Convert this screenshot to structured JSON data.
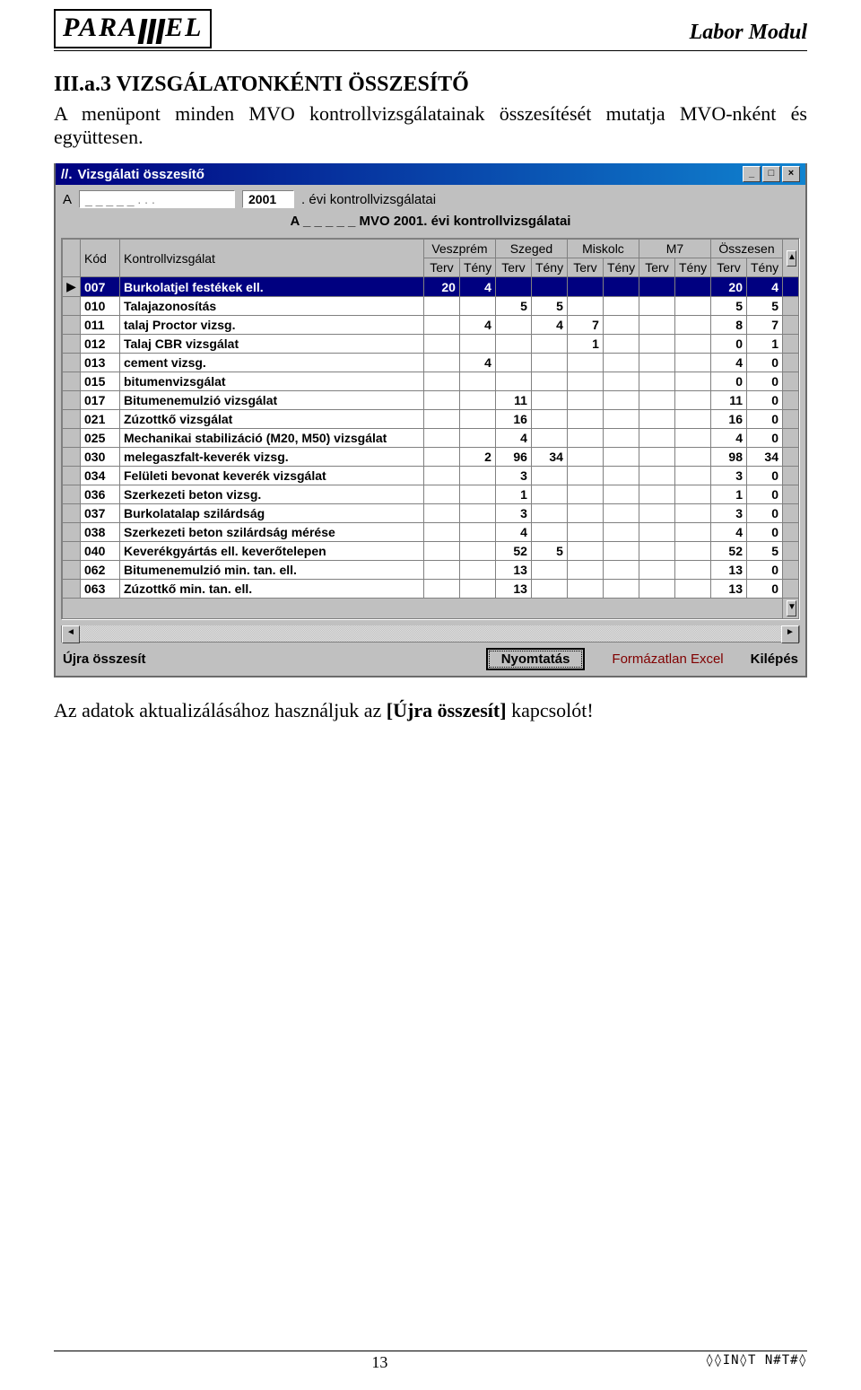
{
  "header": {
    "logo_left": "PARA",
    "logo_right": "EL",
    "doc_title": "Labor Modul"
  },
  "section": {
    "heading": "III.a.3 VIZSGÁLATONKÉNTI ÖSSZESÍTŐ",
    "body": "A menüpont minden MVO kontrollvizsgálatainak összesítését mutatja MVO-nként és együttesen.",
    "tail_pre": "Az adatok aktualizálásához használjuk az ",
    "tail_bold": "[Újra összesít]",
    "tail_post": " kapcsolót!"
  },
  "window": {
    "title": "Vizsgálati összesítő",
    "min": "_",
    "max": "□",
    "close": "×",
    "org_label": "A",
    "org_value": "  _ _ _ _ _ . . .",
    "year": "2001",
    "year_suffix": ". évi kontrollvizsgálatai",
    "subtitle_pre": "A _ _ _ _ _  MVO 2001. évi kontrollvizsgálatai"
  },
  "columns": {
    "marker": "",
    "kod": "Kód",
    "kv": "Kontrollvizsgálat",
    "city1": "Veszprém",
    "city2": "Szeged",
    "city3": "Miskolc",
    "city4": "M7",
    "total": "Összesen",
    "terv": "Terv",
    "teny": "Tény"
  },
  "rows": [
    {
      "code": "007",
      "name": "Burkolatjel festékek ell.",
      "v": [
        "20",
        "4",
        "",
        "",
        "",
        "",
        "",
        "",
        "20",
        "4"
      ],
      "sel": true,
      "marker": "▶"
    },
    {
      "code": "010",
      "name": "Talajazonosítás",
      "v": [
        "",
        "",
        "5",
        "5",
        "",
        "",
        "",
        "",
        "5",
        "5"
      ]
    },
    {
      "code": "011",
      "name": "talaj Proctor vizsg.",
      "v": [
        "",
        "4",
        "",
        "4",
        "7",
        "",
        "",
        "",
        "8",
        "7"
      ]
    },
    {
      "code": "012",
      "name": "Talaj CBR vizsgálat",
      "v": [
        "",
        "",
        "",
        "",
        "1",
        "",
        "",
        "",
        "0",
        "1"
      ]
    },
    {
      "code": "013",
      "name": "cement vizsg.",
      "v": [
        "",
        "4",
        "",
        "",
        "",
        "",
        "",
        "",
        "4",
        "0"
      ]
    },
    {
      "code": "015",
      "name": "bitumenvizsgálat",
      "v": [
        "",
        "",
        "",
        "",
        "",
        "",
        "",
        "",
        "0",
        "0"
      ]
    },
    {
      "code": "017",
      "name": "Bitumenemulzió vizsgálat",
      "v": [
        "",
        "",
        "11",
        "",
        "",
        "",
        "",
        "",
        "11",
        "0"
      ]
    },
    {
      "code": "021",
      "name": "Zúzottkő vizsgálat",
      "v": [
        "",
        "",
        "16",
        "",
        "",
        "",
        "",
        "",
        "16",
        "0"
      ]
    },
    {
      "code": "025",
      "name": "Mechanikai stabilizáció (M20, M50) vizsgálat",
      "v": [
        "",
        "",
        "4",
        "",
        "",
        "",
        "",
        "",
        "4",
        "0"
      ]
    },
    {
      "code": "030",
      "name": "melegaszfalt-keverék vizsg.",
      "v": [
        "",
        "2",
        "96",
        "34",
        "",
        "",
        "",
        "",
        "98",
        "34"
      ]
    },
    {
      "code": "034",
      "name": "Felületi bevonat keverék vizsgálat",
      "v": [
        "",
        "",
        "3",
        "",
        "",
        "",
        "",
        "",
        "3",
        "0"
      ]
    },
    {
      "code": "036",
      "name": "Szerkezeti beton vizsg.",
      "v": [
        "",
        "",
        "1",
        "",
        "",
        "",
        "",
        "",
        "1",
        "0"
      ]
    },
    {
      "code": "037",
      "name": "Burkolatalap szilárdság",
      "v": [
        "",
        "",
        "3",
        "",
        "",
        "",
        "",
        "",
        "3",
        "0"
      ]
    },
    {
      "code": "038",
      "name": "Szerkezeti beton szilárdság mérése",
      "v": [
        "",
        "",
        "4",
        "",
        "",
        "",
        "",
        "",
        "4",
        "0"
      ]
    },
    {
      "code": "040",
      "name": "Keverékgyártás ell. keverőtelepen",
      "v": [
        "",
        "",
        "52",
        "5",
        "",
        "",
        "",
        "",
        "52",
        "5"
      ]
    },
    {
      "code": "062",
      "name": "Bitumenemulzió min. tan. ell.",
      "v": [
        "",
        "",
        "13",
        "",
        "",
        "",
        "",
        "",
        "13",
        "0"
      ]
    },
    {
      "code": "063",
      "name": "Zúzottkő min. tan. ell.",
      "v": [
        "",
        "",
        "13",
        "",
        "",
        "",
        "",
        "",
        "13",
        "0"
      ]
    }
  ],
  "status": {
    "ujra": "Újra összesít",
    "print": "Nyomtatás",
    "excel": "Formázatlan Excel",
    "exit": "Kilépés"
  },
  "footer": {
    "page": "13",
    "code": "◊◊IN◊T N#T#◊"
  }
}
